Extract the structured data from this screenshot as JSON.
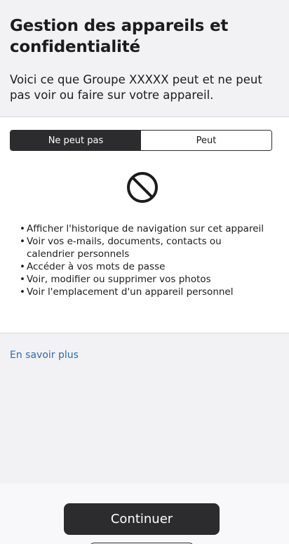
{
  "header": {
    "title": "Gestion des appareils et confidentialité",
    "subtitle": "Voici ce que Groupe XXXXX peut et ne peut pas voir ou faire sur votre appareil."
  },
  "segmented_control": {
    "options": [
      {
        "label": "Ne peut pas",
        "selected": true
      },
      {
        "label": "Peut",
        "selected": false
      }
    ]
  },
  "icon": {
    "name": "prohibited-icon"
  },
  "cannot_list": [
    "Afficher l'historique de navigation sur cet appareil",
    "Voir vos e-mails, documents, contacts ou calendrier personnels",
    "Accéder à vos mots de passe",
    "Voir, modifier ou supprimer vos photos",
    "Voir l'emplacement d'un appareil personnel"
  ],
  "learn_more": {
    "label": "En savoir plus"
  },
  "footer": {
    "continue_label": "Continuer"
  },
  "colors": {
    "accent_dark": "#2c2c2e",
    "link": "#2a6db3",
    "background": "#f2f2f4",
    "card": "#ffffff"
  }
}
